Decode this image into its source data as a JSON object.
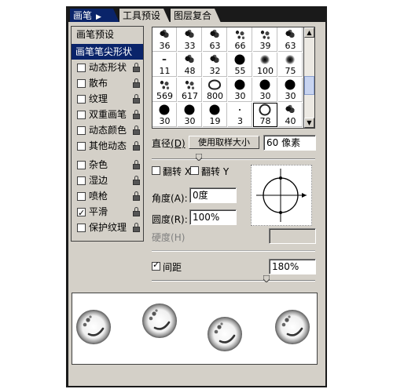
{
  "tabs": [
    {
      "label": "画笔",
      "active": true
    },
    {
      "label": "工具预设",
      "active": false
    },
    {
      "label": "图层复合",
      "active": false
    }
  ],
  "left_panel": {
    "items": [
      {
        "label": "画笔预设",
        "type": "header",
        "checked": null,
        "locked": false
      },
      {
        "label": "画笔笔尖形状",
        "type": "selected",
        "checked": null,
        "locked": false
      },
      {
        "label": "动态形状",
        "type": "option",
        "checked": false,
        "locked": true
      },
      {
        "label": "散布",
        "type": "option",
        "checked": false,
        "locked": true
      },
      {
        "label": "纹理",
        "type": "option",
        "checked": false,
        "locked": true
      },
      {
        "label": "双重画笔",
        "type": "option",
        "checked": false,
        "locked": true
      },
      {
        "label": "动态颜色",
        "type": "option",
        "checked": false,
        "locked": true
      },
      {
        "label": "其他动态",
        "type": "option",
        "checked": false,
        "locked": true
      },
      {
        "label": "杂色",
        "type": "option",
        "checked": false,
        "locked": true
      },
      {
        "label": "湿边",
        "type": "option",
        "checked": false,
        "locked": true
      },
      {
        "label": "喷枪",
        "type": "option",
        "checked": false,
        "locked": true
      },
      {
        "label": "平滑",
        "type": "option",
        "checked": true,
        "locked": true
      },
      {
        "label": "保护纹理",
        "type": "option",
        "checked": false,
        "locked": true
      }
    ]
  },
  "brush_grid": [
    [
      "36",
      "33",
      "63",
      "66",
      "39",
      "63"
    ],
    [
      "11",
      "48",
      "32",
      "55",
      "100",
      "75"
    ],
    [
      "569",
      "617",
      "800",
      "30",
      "30",
      "30"
    ],
    [
      "30",
      "30",
      "19",
      "3",
      "78",
      "40"
    ]
  ],
  "brush_icons": [
    [
      "leaf-brush-icon",
      "leaf-brush-icon",
      "leaf-brush-icon",
      "scatter-brush-icon",
      "scatter-brush-icon",
      "leaf-brush-icon"
    ],
    [
      "dash-brush-icon",
      "leaf-brush-icon",
      "leaf-brush-icon",
      "hard-round-brush-icon",
      "soft-round-brush-icon",
      "soft-round-brush-icon"
    ],
    [
      "scatter-brush-icon",
      "scatter-brush-icon",
      "heart-brush-icon",
      "hard-round-brush-icon",
      "hard-round-brush-icon",
      "hard-round-brush-icon"
    ],
    [
      "hard-round-brush-icon",
      "hard-round-brush-icon",
      "hard-round-brush-icon",
      "dot-brush-icon",
      "smiley-brush-icon",
      "leaf-brush-icon"
    ]
  ],
  "diameter": {
    "label": "直径",
    "key": "(D)",
    "button": "使用取样大小",
    "value": "60 像素"
  },
  "flip_x": {
    "label": "翻转 X",
    "checked": false
  },
  "flip_y": {
    "label": "翻转 Y",
    "checked": false
  },
  "angle": {
    "label": "角度",
    "key": "(A)",
    "value": "0度"
  },
  "roundness": {
    "label": "圆度",
    "key": "(R)",
    "value": "100%"
  },
  "hardness": {
    "label": "硬度",
    "key": "(H)",
    "value": ""
  },
  "spacing": {
    "label": "间距",
    "checked": true,
    "value": "180%"
  },
  "colors": {
    "selection": "#0a246a",
    "panel": "#d4d0c8"
  }
}
